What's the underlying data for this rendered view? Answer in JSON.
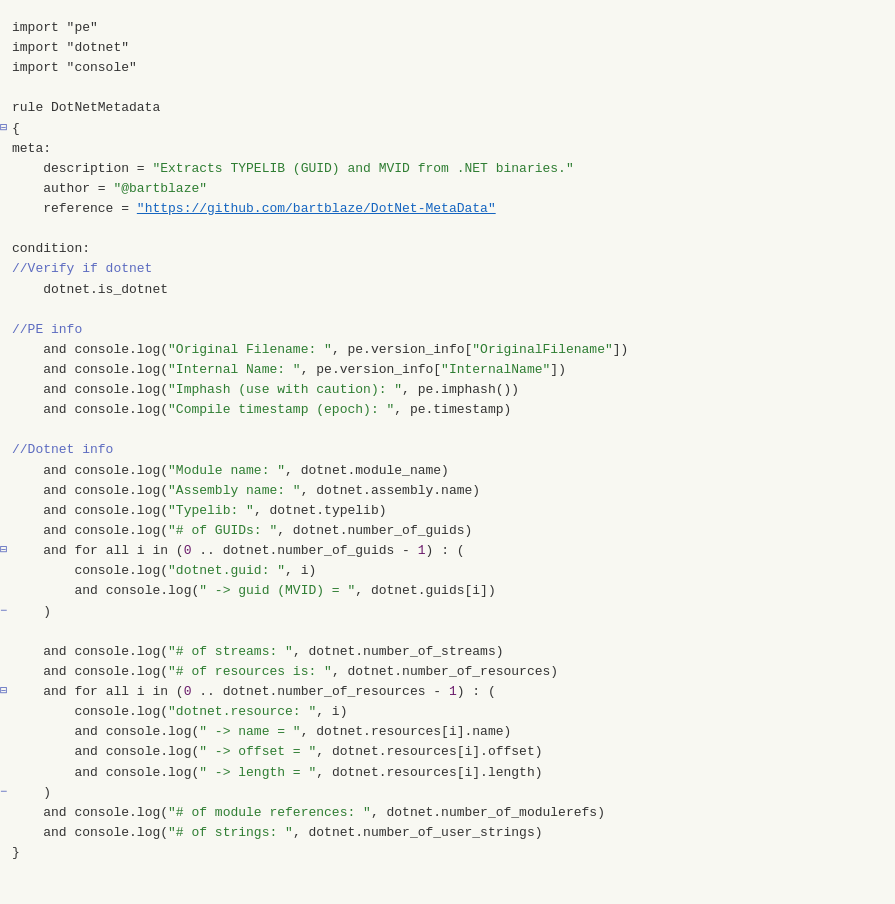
{
  "code": {
    "lines": [
      {
        "id": 1,
        "marker": "",
        "text": [
          {
            "t": "import",
            "c": "plain"
          },
          {
            "t": " \"pe\"",
            "c": "plain"
          }
        ]
      },
      {
        "id": 2,
        "marker": "",
        "text": [
          {
            "t": "import",
            "c": "plain"
          },
          {
            "t": " \"dotnet\"",
            "c": "plain"
          }
        ]
      },
      {
        "id": 3,
        "marker": "",
        "text": [
          {
            "t": "import",
            "c": "plain"
          },
          {
            "t": " \"console\"",
            "c": "plain"
          }
        ]
      },
      {
        "id": 4,
        "marker": "",
        "text": []
      },
      {
        "id": 5,
        "marker": "",
        "text": [
          {
            "t": "rule DotNetMetadata",
            "c": "plain"
          }
        ]
      },
      {
        "id": 6,
        "marker": "⊟",
        "text": [
          {
            "t": "{",
            "c": "plain"
          }
        ]
      },
      {
        "id": 7,
        "marker": "",
        "text": [
          {
            "t": "meta:",
            "c": "plain"
          }
        ]
      },
      {
        "id": 8,
        "marker": "",
        "text": [
          {
            "t": "    description = ",
            "c": "plain"
          },
          {
            "t": "\"Extracts TYPELIB (GUID) and MVID from .NET binaries.\"",
            "c": "str"
          }
        ]
      },
      {
        "id": 9,
        "marker": "",
        "text": [
          {
            "t": "    author = ",
            "c": "plain"
          },
          {
            "t": "\"@bartblaze\"",
            "c": "str"
          }
        ]
      },
      {
        "id": 10,
        "marker": "",
        "text": [
          {
            "t": "    reference = ",
            "c": "plain"
          },
          {
            "t": "\"https://github.com/bartblaze/DotNet-MetaData\"",
            "c": "link"
          }
        ]
      },
      {
        "id": 11,
        "marker": "",
        "text": []
      },
      {
        "id": 12,
        "marker": "",
        "text": [
          {
            "t": "condition:",
            "c": "plain"
          }
        ]
      },
      {
        "id": 13,
        "marker": "",
        "text": [
          {
            "t": "//Verify if dotnet",
            "c": "comment"
          }
        ]
      },
      {
        "id": 14,
        "marker": "",
        "text": [
          {
            "t": "    dotnet.is_dotnet",
            "c": "plain"
          }
        ]
      },
      {
        "id": 15,
        "marker": "",
        "text": []
      },
      {
        "id": 16,
        "marker": "",
        "text": [
          {
            "t": "//PE info",
            "c": "comment"
          }
        ]
      },
      {
        "id": 17,
        "marker": "",
        "text": [
          {
            "t": "    ",
            "c": "plain"
          },
          {
            "t": "and",
            "c": "plain"
          },
          {
            "t": " console.log(",
            "c": "plain"
          },
          {
            "t": "\"Original Filename: \"",
            "c": "str"
          },
          {
            "t": ", pe.version_info[",
            "c": "plain"
          },
          {
            "t": "\"OriginalFilename\"",
            "c": "str"
          },
          {
            "t": "])",
            "c": "plain"
          }
        ]
      },
      {
        "id": 18,
        "marker": "",
        "text": [
          {
            "t": "    ",
            "c": "plain"
          },
          {
            "t": "and",
            "c": "plain"
          },
          {
            "t": " console.log(",
            "c": "plain"
          },
          {
            "t": "\"Internal Name: \"",
            "c": "str"
          },
          {
            "t": ", pe.version_info[",
            "c": "plain"
          },
          {
            "t": "\"InternalName\"",
            "c": "str"
          },
          {
            "t": "])",
            "c": "plain"
          }
        ]
      },
      {
        "id": 19,
        "marker": "",
        "text": [
          {
            "t": "    ",
            "c": "plain"
          },
          {
            "t": "and",
            "c": "plain"
          },
          {
            "t": " console.log(",
            "c": "plain"
          },
          {
            "t": "\"Imphash (use with caution): \"",
            "c": "str"
          },
          {
            "t": ", pe.imphash())",
            "c": "plain"
          }
        ]
      },
      {
        "id": 20,
        "marker": "",
        "text": [
          {
            "t": "    ",
            "c": "plain"
          },
          {
            "t": "and",
            "c": "plain"
          },
          {
            "t": " console.log(",
            "c": "plain"
          },
          {
            "t": "\"Compile timestamp (epoch): \"",
            "c": "str"
          },
          {
            "t": ", pe.timestamp)",
            "c": "plain"
          }
        ]
      },
      {
        "id": 21,
        "marker": "",
        "text": []
      },
      {
        "id": 22,
        "marker": "",
        "text": [
          {
            "t": "//Dotnet info",
            "c": "comment"
          }
        ]
      },
      {
        "id": 23,
        "marker": "",
        "text": [
          {
            "t": "    ",
            "c": "plain"
          },
          {
            "t": "and",
            "c": "plain"
          },
          {
            "t": " console.log(",
            "c": "plain"
          },
          {
            "t": "\"Module name: \"",
            "c": "str"
          },
          {
            "t": ", dotnet.module_name)",
            "c": "plain"
          }
        ]
      },
      {
        "id": 24,
        "marker": "",
        "text": [
          {
            "t": "    ",
            "c": "plain"
          },
          {
            "t": "and",
            "c": "plain"
          },
          {
            "t": " console.log(",
            "c": "plain"
          },
          {
            "t": "\"Assembly name: \"",
            "c": "str"
          },
          {
            "t": ", dotnet.assembly.name)",
            "c": "plain"
          }
        ]
      },
      {
        "id": 25,
        "marker": "",
        "text": [
          {
            "t": "    ",
            "c": "plain"
          },
          {
            "t": "and",
            "c": "plain"
          },
          {
            "t": " console.log(",
            "c": "plain"
          },
          {
            "t": "\"Typelib: \"",
            "c": "str"
          },
          {
            "t": ", dotnet.typelib)",
            "c": "plain"
          }
        ]
      },
      {
        "id": 26,
        "marker": "",
        "text": [
          {
            "t": "    ",
            "c": "plain"
          },
          {
            "t": "and",
            "c": "plain"
          },
          {
            "t": " console.log(",
            "c": "plain"
          },
          {
            "t": "\"# of GUIDs: \"",
            "c": "str"
          },
          {
            "t": ", dotnet.number_of_guids)",
            "c": "plain"
          }
        ]
      },
      {
        "id": 27,
        "marker": "⊟",
        "text": [
          {
            "t": "    ",
            "c": "plain"
          },
          {
            "t": "and",
            "c": "plain"
          },
          {
            "t": " ",
            "c": "plain"
          },
          {
            "t": "for",
            "c": "plain"
          },
          {
            "t": " all i in (",
            "c": "plain"
          },
          {
            "t": "0",
            "c": "num"
          },
          {
            "t": " .. dotnet.number_of_guids - ",
            "c": "plain"
          },
          {
            "t": "1",
            "c": "num"
          },
          {
            "t": ") : (",
            "c": "plain"
          }
        ]
      },
      {
        "id": 28,
        "marker": "",
        "text": [
          {
            "t": "        console.log(",
            "c": "plain"
          },
          {
            "t": "\"dotnet.guid: \"",
            "c": "str"
          },
          {
            "t": ", i)",
            "c": "plain"
          }
        ]
      },
      {
        "id": 29,
        "marker": "",
        "text": [
          {
            "t": "        ",
            "c": "plain"
          },
          {
            "t": "and",
            "c": "plain"
          },
          {
            "t": " console.log(",
            "c": "plain"
          },
          {
            "t": "\" -> guid (MVID) = \"",
            "c": "str"
          },
          {
            "t": ", dotnet.guids[i])",
            "c": "plain"
          }
        ]
      },
      {
        "id": 30,
        "marker": "−",
        "text": [
          {
            "t": "    )",
            "c": "plain"
          }
        ]
      },
      {
        "id": 31,
        "marker": "",
        "text": []
      },
      {
        "id": 32,
        "marker": "",
        "text": [
          {
            "t": "    ",
            "c": "plain"
          },
          {
            "t": "and",
            "c": "plain"
          },
          {
            "t": " console.log(",
            "c": "plain"
          },
          {
            "t": "\"# of streams: \"",
            "c": "str"
          },
          {
            "t": ", dotnet.number_of_streams)",
            "c": "plain"
          }
        ]
      },
      {
        "id": 33,
        "marker": "",
        "text": [
          {
            "t": "    ",
            "c": "plain"
          },
          {
            "t": "and",
            "c": "plain"
          },
          {
            "t": " console.log(",
            "c": "plain"
          },
          {
            "t": "\"# of resources is: \"",
            "c": "str"
          },
          {
            "t": ", dotnet.number_of_resources)",
            "c": "plain"
          }
        ]
      },
      {
        "id": 34,
        "marker": "⊟",
        "text": [
          {
            "t": "    ",
            "c": "plain"
          },
          {
            "t": "and",
            "c": "plain"
          },
          {
            "t": " ",
            "c": "plain"
          },
          {
            "t": "for",
            "c": "plain"
          },
          {
            "t": " all i in (",
            "c": "plain"
          },
          {
            "t": "0",
            "c": "num"
          },
          {
            "t": " .. dotnet.number_of_resources - ",
            "c": "plain"
          },
          {
            "t": "1",
            "c": "num"
          },
          {
            "t": ") : (",
            "c": "plain"
          }
        ]
      },
      {
        "id": 35,
        "marker": "",
        "text": [
          {
            "t": "        console.log(",
            "c": "plain"
          },
          {
            "t": "\"dotnet.resource: \"",
            "c": "str"
          },
          {
            "t": ", i)",
            "c": "plain"
          }
        ]
      },
      {
        "id": 36,
        "marker": "",
        "text": [
          {
            "t": "        ",
            "c": "plain"
          },
          {
            "t": "and",
            "c": "plain"
          },
          {
            "t": " console.log(",
            "c": "plain"
          },
          {
            "t": "\" -> name = \"",
            "c": "str"
          },
          {
            "t": ", dotnet.resources[i].name)",
            "c": "plain"
          }
        ]
      },
      {
        "id": 37,
        "marker": "",
        "text": [
          {
            "t": "        ",
            "c": "plain"
          },
          {
            "t": "and",
            "c": "plain"
          },
          {
            "t": " console.log(",
            "c": "plain"
          },
          {
            "t": "\" -> offset = \"",
            "c": "str"
          },
          {
            "t": ", dotnet.resources[i].offset)",
            "c": "plain"
          }
        ]
      },
      {
        "id": 38,
        "marker": "",
        "text": [
          {
            "t": "        ",
            "c": "plain"
          },
          {
            "t": "and",
            "c": "plain"
          },
          {
            "t": " console.log(",
            "c": "plain"
          },
          {
            "t": "\" -> length = \"",
            "c": "str"
          },
          {
            "t": ", dotnet.resources[i].length)",
            "c": "plain"
          }
        ]
      },
      {
        "id": 39,
        "marker": "−",
        "text": [
          {
            "t": "    )",
            "c": "plain"
          }
        ]
      },
      {
        "id": 40,
        "marker": "",
        "text": [
          {
            "t": "    ",
            "c": "plain"
          },
          {
            "t": "and",
            "c": "plain"
          },
          {
            "t": " console.log(",
            "c": "plain"
          },
          {
            "t": "\"# of module references: \"",
            "c": "str"
          },
          {
            "t": ", dotnet.number_of_modulerefs)",
            "c": "plain"
          }
        ]
      },
      {
        "id": 41,
        "marker": "",
        "text": [
          {
            "t": "    ",
            "c": "plain"
          },
          {
            "t": "and",
            "c": "plain"
          },
          {
            "t": " console.log(",
            "c": "plain"
          },
          {
            "t": "\"# of strings: \"",
            "c": "str"
          },
          {
            "t": ", dotnet.number_of_user_strings)",
            "c": "plain"
          }
        ]
      },
      {
        "id": 42,
        "marker": "",
        "text": [
          {
            "t": "}",
            "c": "plain"
          }
        ]
      }
    ]
  }
}
